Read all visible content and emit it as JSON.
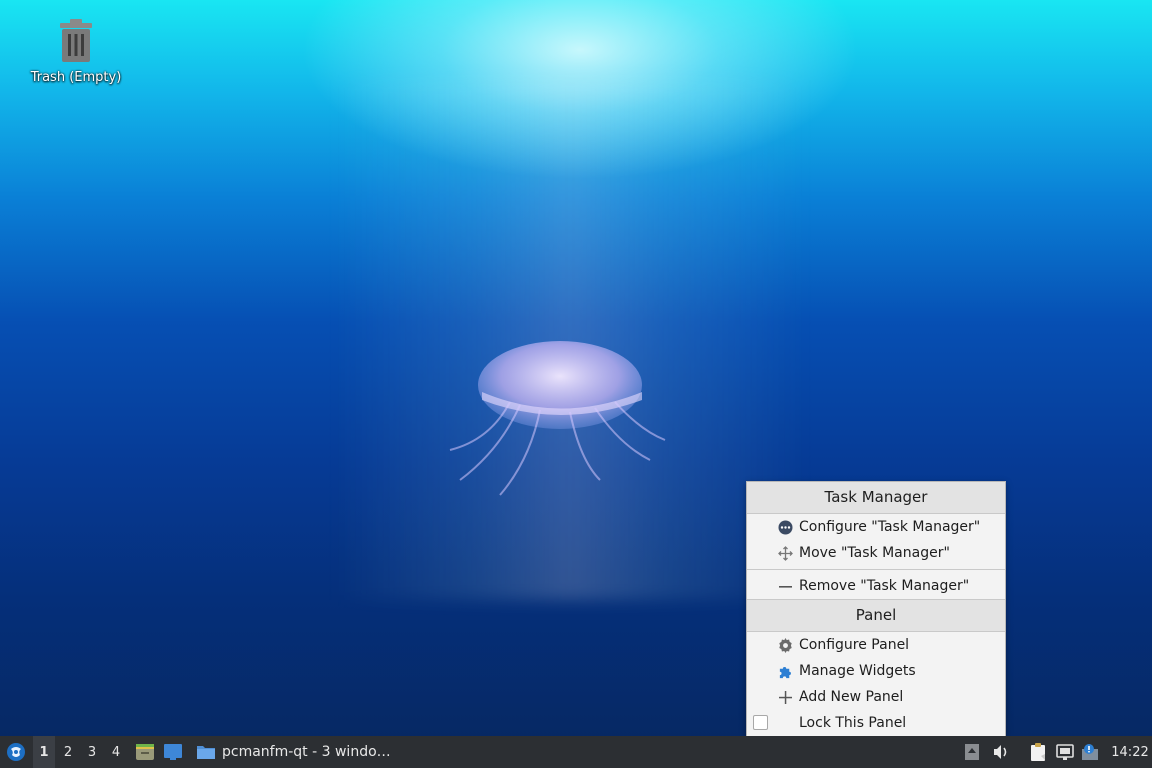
{
  "desktop": {
    "trash_label": "Trash (Empty)"
  },
  "context_menu": {
    "task_manager_header": "Task Manager",
    "configure_task_manager": "Configure \"Task Manager\"",
    "move_task_manager": "Move \"Task Manager\"",
    "remove_task_manager": "Remove \"Task Manager\"",
    "panel_header": "Panel",
    "configure_panel": "Configure Panel",
    "manage_widgets": "Manage Widgets",
    "add_new_panel": "Add New Panel",
    "lock_this_panel": "Lock This Panel",
    "lock_checked": false
  },
  "taskbar": {
    "desktops": [
      "1",
      "2",
      "3",
      "4"
    ],
    "active_desktop": "1",
    "task_label": "pcmanfm-qt - 3 windo…",
    "clock": "14:22"
  },
  "icons": {
    "start": "lxqt-start-icon",
    "trash": "trash-icon",
    "quicklaunch_1": "file-manager-icon",
    "quicklaunch_2": "show-desktop-icon",
    "task": "folder-icon",
    "tray": [
      "tray-expand-icon",
      "volume-icon",
      "clipboard-icon",
      "network-icon",
      "update-notifier-icon"
    ]
  },
  "colors": {
    "taskbar_bg": "#2c2f33",
    "menu_bg": "#f3f3f3",
    "accent_blue": "#2d7fd3"
  }
}
